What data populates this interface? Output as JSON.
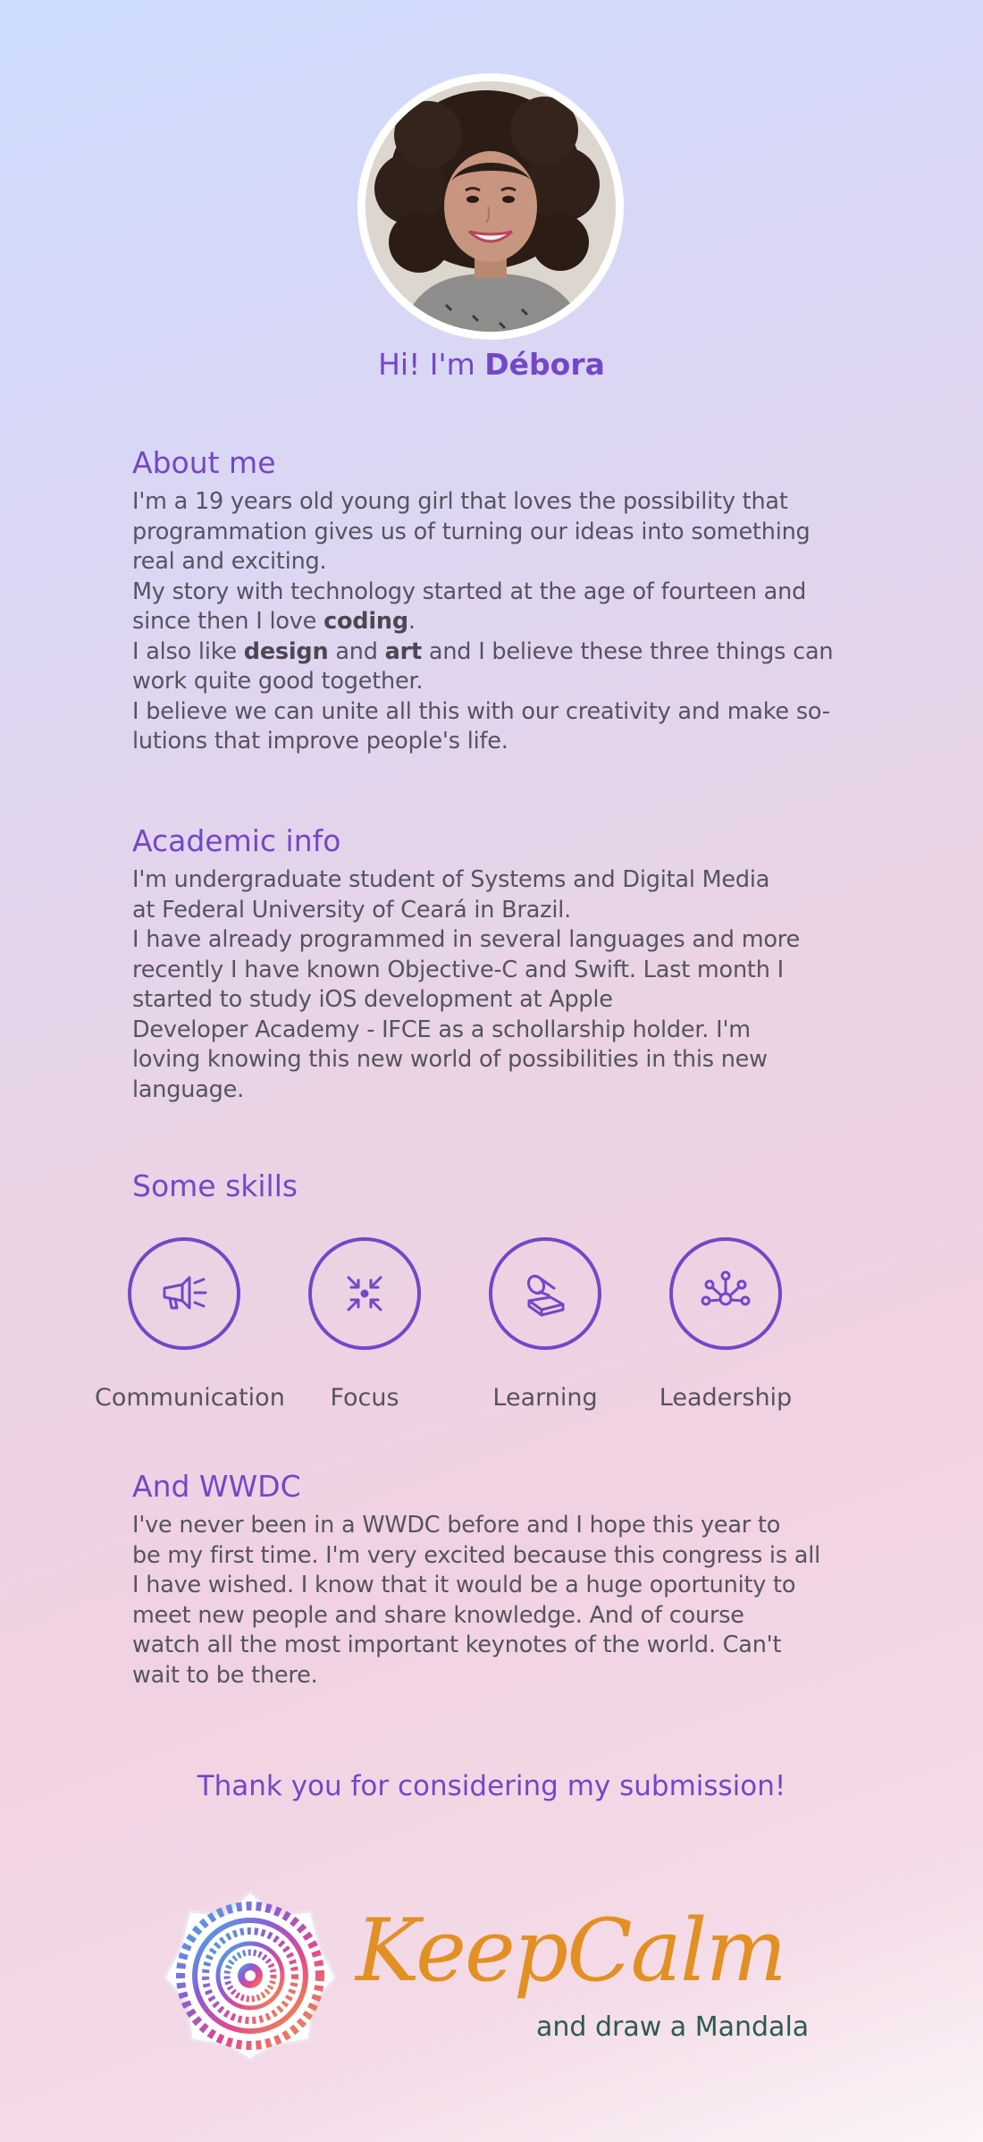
{
  "profile": {
    "greeting_prefix": "Hi! I'm ",
    "name": "Débora"
  },
  "about": {
    "title": "About me",
    "lines": [
      [
        "I'm a 19 years old young girl that loves the possibility that"
      ],
      [
        "programmation gives us of turning our ideas into something"
      ],
      [
        "real and exciting."
      ],
      [
        "My story with technology started at the age of fourteen and"
      ],
      [
        "since then I love ",
        "coding",
        "."
      ],
      [
        "I also like ",
        "design",
        " and ",
        "art",
        " and I believe these three things can"
      ],
      [
        "work quite good together."
      ],
      [
        "I believe we can unite all this with our creativity and make so-"
      ],
      [
        "lutions that improve people's life."
      ]
    ],
    "l0": "I'm a 19 years old young girl that loves the possibility that",
    "l1": "programmation gives us of turning our ideas into something",
    "l2": "real and exciting.",
    "l3": "My story with technology started at the age of fourteen and",
    "l4a": "since then I love ",
    "l4b": "coding",
    "l4c": ".",
    "l5a": "I also like ",
    "l5b": "design",
    "l5c": " and ",
    "l5d": "art",
    "l5e": " and I believe these three things can",
    "l6": "work quite good together.",
    "l7": "I believe we can unite all this with our creativity and make so-",
    "l8": "lutions that improve people's life."
  },
  "academic": {
    "title": "Academic info",
    "l0": "I'm undergraduate student of Systems and Digital Media",
    "l1": "at Federal University of Ceará in Brazil.",
    "l2": "I have already programmed in several languages and more",
    "l3": "recently I have known Objective-C and Swift. Last month I",
    "l4": "started to study iOS development at Apple",
    "l5": "Developer Academy - IFCE as a schollarship holder. I'm",
    "l6": "loving knowing this new world of possibilities in this new",
    "l7": "language."
  },
  "skills": {
    "title": "Some skills",
    "items": [
      {
        "label": "Communication",
        "icon": "megaphone-icon"
      },
      {
        "label": "Focus",
        "icon": "focus-arrows-icon"
      },
      {
        "label": "Learning",
        "icon": "book-lamp-icon"
      },
      {
        "label": "Leadership",
        "icon": "network-icon"
      }
    ]
  },
  "wwdc": {
    "title": "And WWDC",
    "l0": "I've never been in a WWDC before and I hope this year to",
    "l1": "be my first time. I'm very excited because this congress is all",
    "l2": "I have wished. I know that it would be a huge oportunity to",
    "l3": "meet new people and share knowledge. And of course",
    "l4": "watch all the most important keynotes of the world. Can't",
    "l5": "wait to be there."
  },
  "thanks": "Thank you for considering my submission!",
  "logo": {
    "title": "KeepCalm",
    "subtitle": "and draw a Mandala",
    "icon": "mandala-icon"
  },
  "colors": {
    "accent": "#7447c7",
    "text": "#55535f",
    "logo_orange": "#e29024",
    "logo_green": "#2e5a4f"
  }
}
